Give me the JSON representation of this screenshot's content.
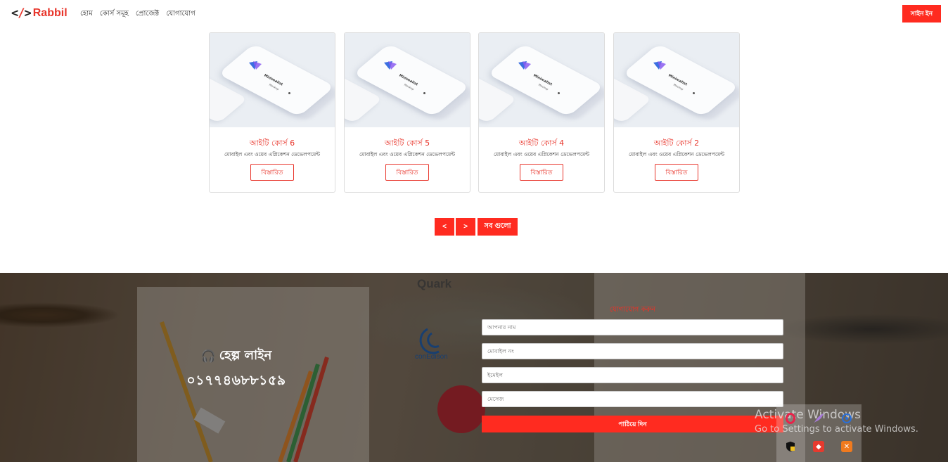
{
  "brand": {
    "code": "</>",
    "name": "Rabbil"
  },
  "nav": {
    "links": [
      "হোম",
      "কোর্স সমূহ",
      "প্রোজেক্ট",
      "যোগাযোগ"
    ],
    "signin_label": "সাইন ইন"
  },
  "courses": [
    {
      "title": "আইটি কোর্স 6",
      "description": "মোবাইল এবং ওয়েব এপ্লিকেশন ডেভেলপমেন্ট",
      "button": "বিস্তারিত",
      "mockup_title": "Minimalist",
      "mockup_sub": "Mockup"
    },
    {
      "title": "আইটি কোর্স 5",
      "description": "মোবাইল এবং ওয়েব এপ্লিকেশন ডেভেলপমেন্ট",
      "button": "বিস্তারিত",
      "mockup_title": "Minimalist",
      "mockup_sub": "Mockup"
    },
    {
      "title": "আইটি কোর্স 4",
      "description": "মোবাইল এবং ওয়েব এপ্লিকেশন ডেভেলপমেন্ট",
      "button": "বিস্তারিত",
      "mockup_title": "Minimalist",
      "mockup_sub": "Mockup"
    },
    {
      "title": "আইটি কোর্স 2",
      "description": "মোবাইল এবং ওয়েব এপ্লিকেশন ডেভেলপমেন্ট",
      "button": "বিস্তারিত",
      "mockup_title": "Minimalist",
      "mockup_sub": "Mockup"
    }
  ],
  "pagination": {
    "prev": "<",
    "next": ">",
    "all": "সব গুলো"
  },
  "footer": {
    "background_brands": {
      "quark": "Quark",
      "conedison": "conEdison"
    },
    "helpline_title": "হেল্প লাইন",
    "helpline_number": "০১৭৭৪৬৮৮১৫৯",
    "contact_title": "যোগাযোগ করুন",
    "fields": {
      "name": "আপনার নাম",
      "mobile": "মোবাইল নং",
      "email": "ইমেইল",
      "message": "মেসেজ"
    },
    "send_label": "পাঠিয়ে দিন"
  },
  "windows_watermark": {
    "title": "Activate Windows",
    "subtitle": "Go to Settings to activate Windows."
  },
  "tray_icons": [
    "opera-icon",
    "feather-icon",
    "network-icon",
    "shield-icon",
    "anydesk-icon",
    "xampp-icon"
  ],
  "colors": {
    "accent": "#ff2b20",
    "brand_text": "#e8352b"
  }
}
